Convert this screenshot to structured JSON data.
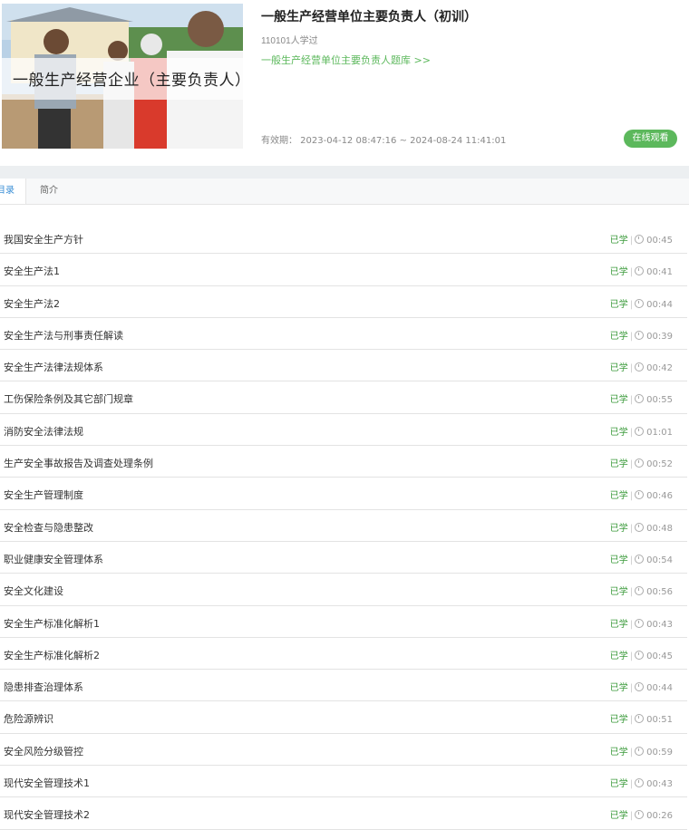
{
  "course": {
    "cover_text": "一般生产经营企业（主要负责人）",
    "title": "一般生产经营单位主要负责人（初训）",
    "learners": "110101人学过",
    "question_bank_link": "一般生产经营单位主要负责人题库 >>",
    "validity": "有效期： 2023-04-12 08:47:16 ~ 2024-08-24 11:41:01",
    "watch_button": "在线观看"
  },
  "tabs": [
    {
      "label": "目录",
      "active": true
    },
    {
      "label": "简介",
      "active": false
    }
  ],
  "lessons": [
    {
      "title": "我国安全生产方针",
      "status": "已学",
      "duration": "00:45"
    },
    {
      "title": "安全生产法1",
      "status": "已学",
      "duration": "00:41"
    },
    {
      "title": "安全生产法2",
      "status": "已学",
      "duration": "00:44"
    },
    {
      "title": "安全生产法与刑事责任解读",
      "status": "已学",
      "duration": "00:39"
    },
    {
      "title": "安全生产法律法规体系",
      "status": "已学",
      "duration": "00:42"
    },
    {
      "title": "工伤保险条例及其它部门规章",
      "status": "已学",
      "duration": "00:55"
    },
    {
      "title": "消防安全法律法规",
      "status": "已学",
      "duration": "01:01"
    },
    {
      "title": "生产安全事故报告及调查处理条例",
      "status": "已学",
      "duration": "00:52"
    },
    {
      "title": "安全生产管理制度",
      "status": "已学",
      "duration": "00:46"
    },
    {
      "title": "安全检查与隐患整改",
      "status": "已学",
      "duration": "00:48"
    },
    {
      "title": "职业健康安全管理体系",
      "status": "已学",
      "duration": "00:54"
    },
    {
      "title": "安全文化建设",
      "status": "已学",
      "duration": "00:56"
    },
    {
      "title": "安全生产标准化解析1",
      "status": "已学",
      "duration": "00:43"
    },
    {
      "title": "安全生产标准化解析2",
      "status": "已学",
      "duration": "00:45"
    },
    {
      "title": "隐患排查治理体系",
      "status": "已学",
      "duration": "00:44"
    },
    {
      "title": "危险源辨识",
      "status": "已学",
      "duration": "00:51"
    },
    {
      "title": "安全风险分级管控",
      "status": "已学",
      "duration": "00:59"
    },
    {
      "title": "现代安全管理技术1",
      "status": "已学",
      "duration": "00:43"
    },
    {
      "title": "现代安全管理技术2",
      "status": "已学",
      "duration": "00:26"
    }
  ],
  "colors": {
    "accent_green": "#5cb85c",
    "status_green": "#3a9a3a",
    "tab_active_blue": "#3b8fd6"
  }
}
